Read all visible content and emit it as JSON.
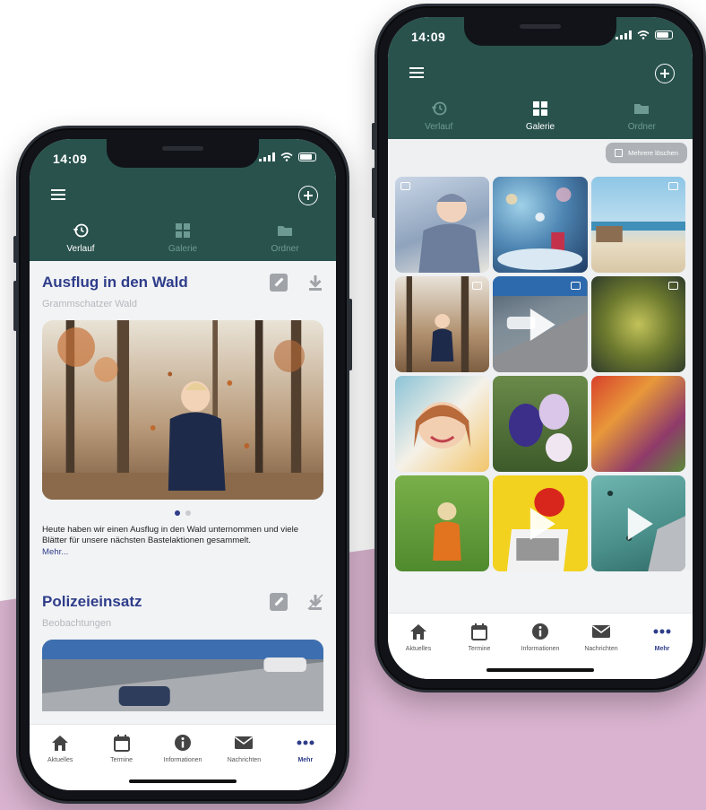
{
  "left_phone": {
    "status_time": "14:09",
    "tabs": [
      {
        "label": "Verlauf",
        "icon": "history-icon",
        "active": true
      },
      {
        "label": "Galerie",
        "icon": "grid-icon",
        "active": false
      },
      {
        "label": "Ordner",
        "icon": "folder-icon",
        "active": false
      }
    ],
    "posts": [
      {
        "title": "Ausflug in den Wald",
        "subtitle": "Grammschatzer Wald",
        "text": "Heute haben wir einen Ausflug in den Wald unternommen und viele Blätter für unsere nächsten Bastelaktionen gesammelt.",
        "more": "Mehr..."
      },
      {
        "title": "Polizeieinsatz",
        "subtitle": "Beobachtungen"
      }
    ],
    "nav": [
      {
        "label": "Aktuelles",
        "icon": "home-icon"
      },
      {
        "label": "Termine",
        "icon": "calendar-icon"
      },
      {
        "label": "Informationen",
        "icon": "info-icon"
      },
      {
        "label": "Nachrichten",
        "icon": "mail-icon"
      },
      {
        "label": "Mehr",
        "icon": "more-icon",
        "active": true
      }
    ]
  },
  "right_phone": {
    "status_time": "14:09",
    "tabs": [
      {
        "label": "Verlauf",
        "icon": "history-icon",
        "active": false
      },
      {
        "label": "Galerie",
        "icon": "grid-icon",
        "active": true
      },
      {
        "label": "Ordner",
        "icon": "folder-icon",
        "active": false
      }
    ],
    "multi_delete_label": "Mehrere löschen",
    "nav": [
      {
        "label": "Aktuelles",
        "icon": "home-icon"
      },
      {
        "label": "Termine",
        "icon": "calendar-icon"
      },
      {
        "label": "Informationen",
        "icon": "info-icon"
      },
      {
        "label": "Nachrichten",
        "icon": "mail-icon"
      },
      {
        "label": "Mehr",
        "icon": "more-icon",
        "active": true
      }
    ]
  },
  "colors": {
    "header_teal": "#29524d",
    "accent_blue": "#2f3d8a",
    "background_pink": "#d9b3cf"
  }
}
